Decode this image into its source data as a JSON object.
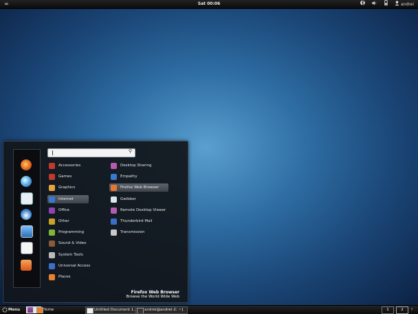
{
  "topbar": {
    "activities_glyph": "∞",
    "clock": "Sat 00:06",
    "user": "andrei",
    "tray_icons": [
      "bluetooth-icon",
      "volume-icon",
      "battery-icon",
      "user-icon"
    ]
  },
  "menu": {
    "search": {
      "value": "",
      "placeholder": ""
    },
    "favorites": [
      "firefox-icon",
      "empathy-icon",
      "remote-desktop-icon",
      "gwibber-icon",
      "display-icon",
      "document-icon",
      "folder-icon"
    ],
    "categories": [
      {
        "label": "Accessories",
        "icon": "accessories-icon",
        "color": "#c0392b"
      },
      {
        "label": "Games",
        "icon": "games-icon",
        "color": "#c0392b"
      },
      {
        "label": "Graphics",
        "icon": "graphics-icon",
        "color": "#e8a33d"
      },
      {
        "label": "Internet",
        "icon": "internet-icon",
        "color": "#3a78c9"
      },
      {
        "label": "Office",
        "icon": "office-icon",
        "color": "#8e44ad"
      },
      {
        "label": "Other",
        "icon": "other-icon",
        "color": "#c9a227"
      },
      {
        "label": "Programming",
        "icon": "programming-icon",
        "color": "#7fb53a"
      },
      {
        "label": "Sound & Video",
        "icon": "sound-video-icon",
        "color": "#8a5a3a"
      },
      {
        "label": "System Tools",
        "icon": "system-tools-icon",
        "color": "#bbbbbb"
      },
      {
        "label": "Universal Access",
        "icon": "universal-access-icon",
        "color": "#3b6ec9"
      },
      {
        "label": "Places",
        "icon": "places-icon",
        "color": "#e6822d"
      }
    ],
    "selected_category": "Internet",
    "apps": [
      {
        "label": "Desktop Sharing",
        "icon": "desktop-sharing-icon",
        "color": "#b55bb0"
      },
      {
        "label": "Empathy",
        "icon": "empathy-icon",
        "color": "#3a78c9"
      },
      {
        "label": "Firefox Web Browser",
        "icon": "firefox-icon",
        "color": "#e8772e"
      },
      {
        "label": "Gwibber",
        "icon": "gwibber-icon",
        "color": "#dde7f0"
      },
      {
        "label": "Remote Desktop Viewer",
        "icon": "remote-desktop-icon",
        "color": "#b55bb0"
      },
      {
        "label": "Thunderbird Mail",
        "icon": "thunderbird-icon",
        "color": "#3b6ec9"
      },
      {
        "label": "Transmission",
        "icon": "transmission-icon",
        "color": "#c9c9c9"
      }
    ],
    "selected_app": "Firefox Web Browser",
    "description": {
      "title": "Firefox Web Browser",
      "subtitle": "Browse the World Wide Web"
    }
  },
  "bottombar": {
    "menu_label": "Menu",
    "tasks": [
      {
        "label": "Home",
        "icon": "folder-icon"
      },
      {
        "label": "[Untitled Document 1...",
        "icon": "text-editor-icon"
      },
      {
        "label": "[andrei@andrei-2: ~]",
        "icon": "terminal-icon"
      }
    ],
    "workspaces": [
      "1",
      "2"
    ],
    "workspace_count": "!"
  }
}
